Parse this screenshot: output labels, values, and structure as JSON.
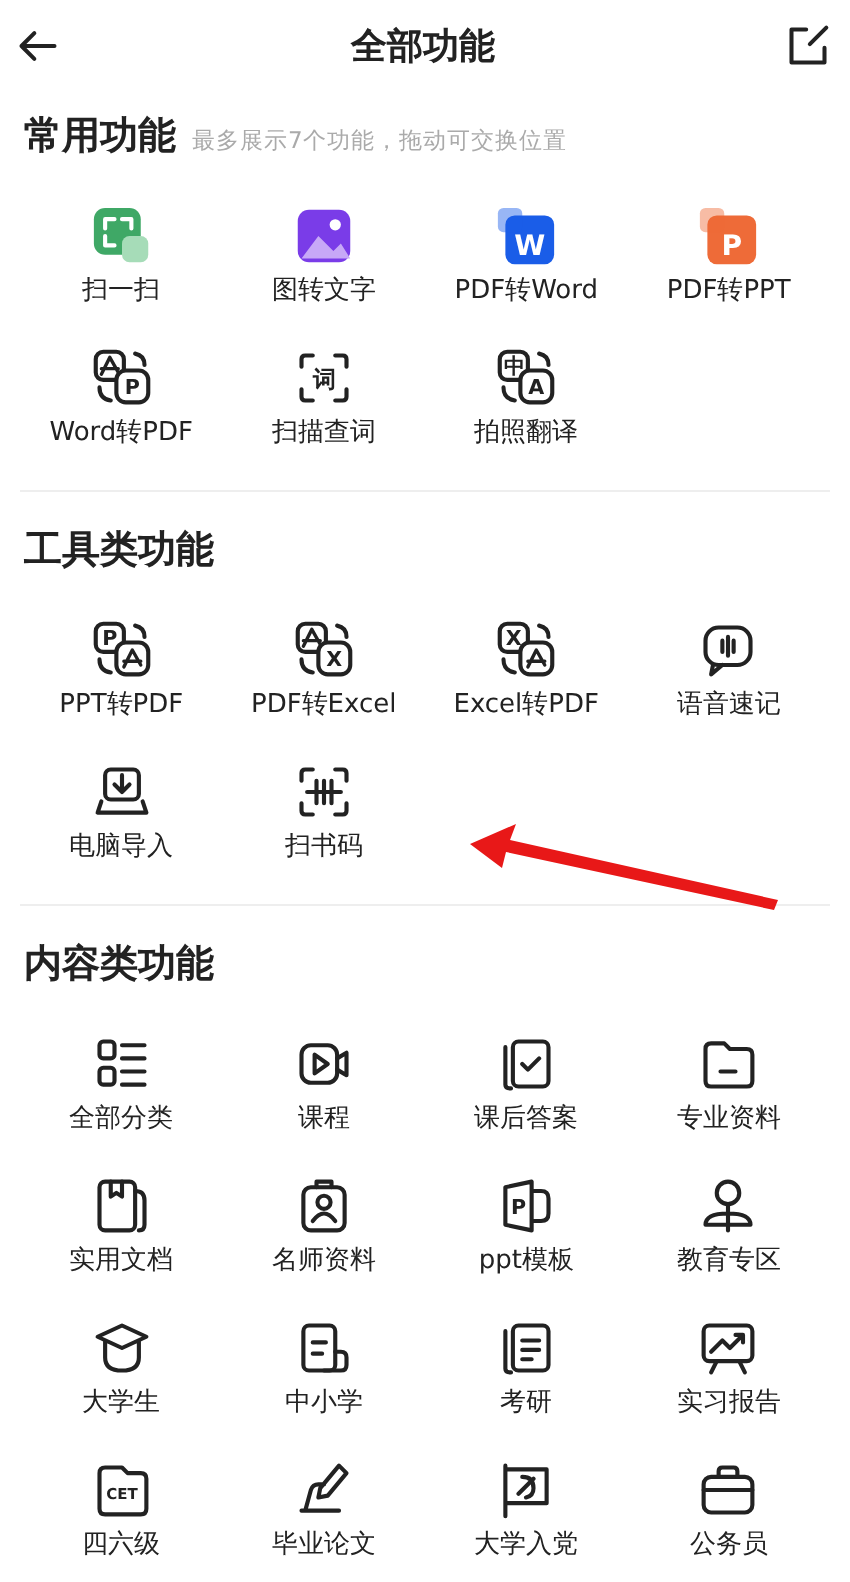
{
  "header": {
    "title": "全部功能"
  },
  "sections": [
    {
      "title": "常用功能",
      "hint": "最多展示7个功能，拖动可交换位置",
      "items": [
        {
          "label": "扫一扫",
          "icon": {
            "kind": "scan-tile"
          }
        },
        {
          "label": "图转文字",
          "icon": {
            "kind": "image-tile"
          }
        },
        {
          "label": "PDF转Word",
          "icon": {
            "kind": "tile",
            "color": "#1a5de8",
            "glyph": "W"
          }
        },
        {
          "label": "PDF转PPT",
          "icon": {
            "kind": "tile",
            "color": "#ee6b38",
            "glyph": "P"
          }
        },
        {
          "label": "Word转PDF",
          "icon": {
            "kind": "convert",
            "front": "P"
          }
        },
        {
          "label": "扫描查词",
          "icon": {
            "kind": "scan-word",
            "glyph": "词"
          }
        },
        {
          "label": "拍照翻译",
          "icon": {
            "kind": "convert",
            "back": "中",
            "front": "A"
          }
        }
      ]
    },
    {
      "title": "工具类功能",
      "items": [
        {
          "label": "PPT转PDF",
          "icon": {
            "kind": "convert",
            "back": "P"
          }
        },
        {
          "label": "PDF转Excel",
          "icon": {
            "kind": "convert",
            "front": "X"
          }
        },
        {
          "label": "Excel转PDF",
          "icon": {
            "kind": "convert",
            "back": "X"
          }
        },
        {
          "label": "语音速记",
          "icon": {
            "kind": "chat-voice"
          }
        },
        {
          "label": "电脑导入",
          "icon": {
            "kind": "laptop-download"
          }
        },
        {
          "label": "扫书码",
          "icon": {
            "kind": "scan-barcode"
          }
        }
      ]
    },
    {
      "title": "内容类功能",
      "items": [
        {
          "label": "全部分类",
          "icon": {
            "kind": "list"
          }
        },
        {
          "label": "课程",
          "icon": {
            "kind": "video"
          }
        },
        {
          "label": "课后答案",
          "icon": {
            "kind": "book-check"
          }
        },
        {
          "label": "专业资料",
          "icon": {
            "kind": "folder"
          }
        },
        {
          "label": "实用文档",
          "icon": {
            "kind": "doc-bookmark"
          }
        },
        {
          "label": "名师资料",
          "icon": {
            "kind": "badge-person"
          }
        },
        {
          "label": "ppt模板",
          "icon": {
            "kind": "ppt-doc",
            "glyph": "P"
          }
        },
        {
          "label": "教育专区",
          "icon": {
            "kind": "person-pin"
          }
        },
        {
          "label": "大学生",
          "icon": {
            "kind": "grad-cap"
          }
        },
        {
          "label": "中小学",
          "icon": {
            "kind": "doc-scroll"
          }
        },
        {
          "label": "考研",
          "icon": {
            "kind": "book-lines"
          }
        },
        {
          "label": "实习报告",
          "icon": {
            "kind": "chart-board"
          }
        },
        {
          "label": "四六级",
          "icon": {
            "kind": "cet-folder",
            "glyph": "CET"
          }
        },
        {
          "label": "毕业论文",
          "icon": {
            "kind": "pen-sign"
          }
        },
        {
          "label": "大学入党",
          "icon": {
            "kind": "flag"
          }
        },
        {
          "label": "公务员",
          "icon": {
            "kind": "briefcase"
          }
        }
      ]
    }
  ]
}
